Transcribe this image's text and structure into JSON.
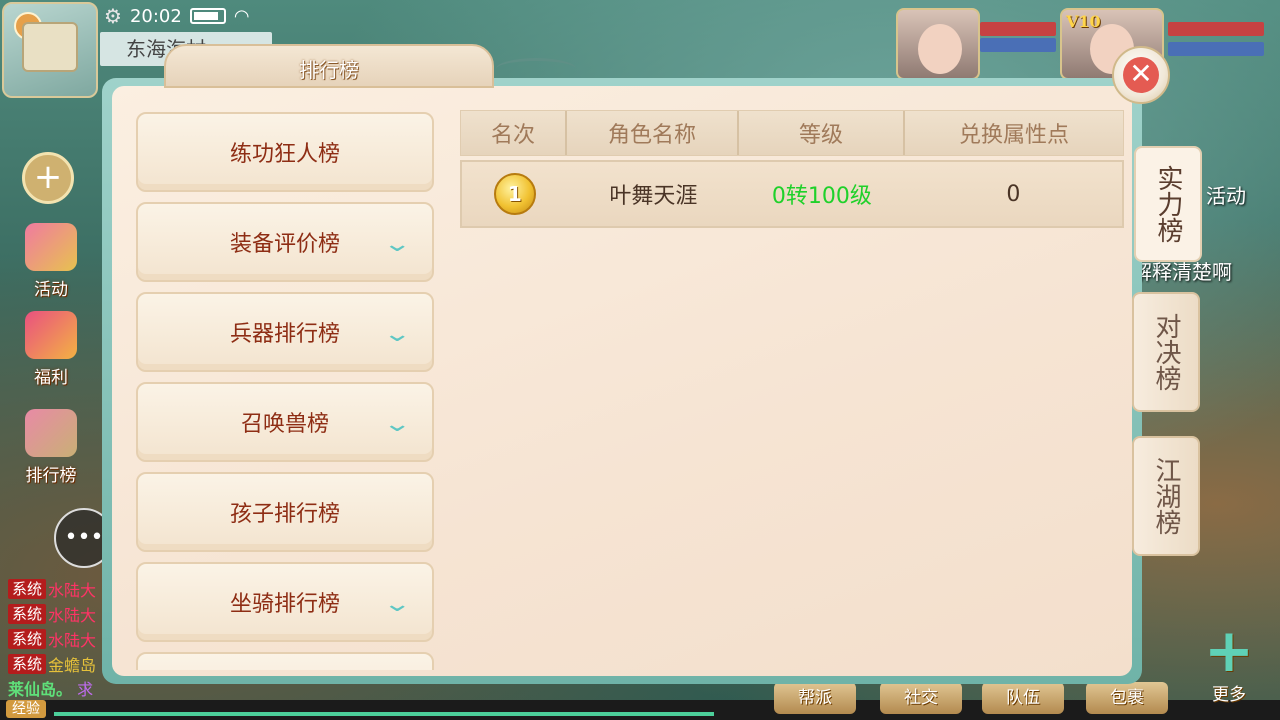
{
  "status_bar": {
    "time": "20:02"
  },
  "region_label": "东海海村",
  "vip_label": "V10",
  "side_menu": [
    {
      "label": "活动",
      "icon": "activity-icon"
    },
    {
      "label": "福利",
      "icon": "gift-icon"
    },
    {
      "label": "排行榜",
      "icon": "ranking-icon"
    }
  ],
  "chat": {
    "rows": [
      {
        "tag": "系统",
        "text": "水陆大"
      },
      {
        "tag": "系统",
        "text": "水陆大"
      },
      {
        "tag": "系统",
        "text": "水陆大"
      },
      {
        "tag": "系统",
        "text": "金蟾岛"
      }
    ],
    "last_line": "莱仙岛。",
    "last_line_purple": "求"
  },
  "exp_label": "经验",
  "scene_text": {
    "activity": "活动",
    "chat_snippet": "解释清楚啊"
  },
  "bottom_bar": [
    "帮派",
    "社交",
    "队伍",
    "包裹"
  ],
  "more_label": "更多",
  "panel": {
    "title": "排行榜",
    "categories": [
      {
        "label": "练功狂人榜",
        "expandable": false
      },
      {
        "label": "装备评价榜",
        "expandable": true
      },
      {
        "label": "兵器排行榜",
        "expandable": true
      },
      {
        "label": "召唤兽榜",
        "expandable": true
      },
      {
        "label": "孩子排行榜",
        "expandable": false
      },
      {
        "label": "坐骑排行榜",
        "expandable": true
      },
      {
        "label": "",
        "expandable": false
      }
    ],
    "table": {
      "headers": [
        "名次",
        "角色名称",
        "等级",
        "兑换属性点"
      ],
      "rows": [
        {
          "rank": "1",
          "name": "叶舞天涯",
          "level": "0转100级",
          "points": "0"
        }
      ]
    },
    "tabs": [
      {
        "label": "实力榜",
        "active": true
      },
      {
        "label": "对决榜",
        "active": false
      },
      {
        "label": "江湖榜",
        "active": false
      }
    ]
  },
  "colors": {
    "level_green": "#1fd12a",
    "category_text": "#8e2d14",
    "close_red": "#e45b52"
  }
}
